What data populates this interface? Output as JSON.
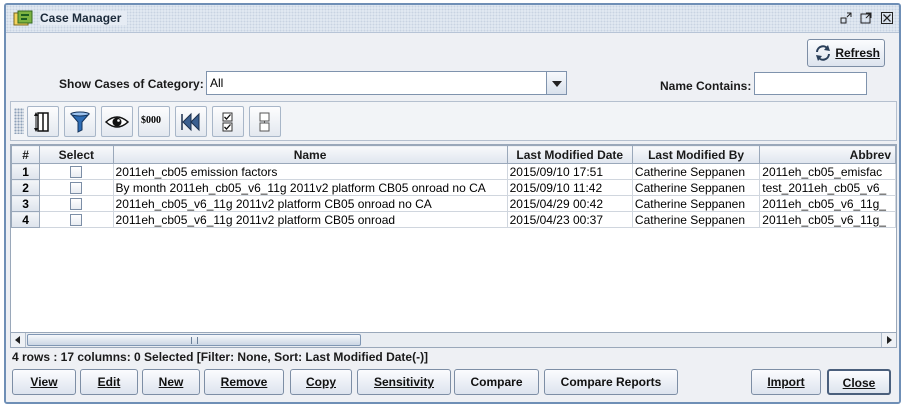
{
  "window": {
    "title": "Case Manager",
    "controls": [
      "minimize-icon",
      "maximize-icon",
      "close-icon"
    ]
  },
  "toolbar_top": {
    "refresh_label": "Refresh"
  },
  "filter": {
    "category_label": "Show Cases of Category:",
    "category_value": "All",
    "name_contains_label": "Name Contains:",
    "name_contains_value": ""
  },
  "icon_toolbar": [
    "column-resize-icon",
    "filter-funnel-icon",
    "view-eye-icon",
    "format-money-icon",
    "rewind-icon",
    "select-all-icon",
    "clear-selection-icon"
  ],
  "icon_toolbar_money_text": "$000",
  "table": {
    "columns": [
      "#",
      "Select",
      "Name",
      "Last Modified Date",
      "Last Modified By",
      "Abbrev"
    ],
    "rows": [
      {
        "num": "1",
        "name": "2011eh_cb05 emission factors",
        "date": "2015/09/10 17:51",
        "by": "Catherine Seppanen",
        "abbrev": "2011eh_cb05_emisfac"
      },
      {
        "num": "2",
        "name": "By month 2011eh_cb05_v6_11g 2011v2 platform CB05 onroad no CA",
        "date": "2015/09/10 11:42",
        "by": "Catherine Seppanen",
        "abbrev": "test_2011eh_cb05_v6_"
      },
      {
        "num": "3",
        "name": "2011eh_cb05_v6_11g 2011v2 platform CB05 onroad no CA",
        "date": "2015/04/29 00:42",
        "by": "Catherine Seppanen",
        "abbrev": "2011eh_cb05_v6_11g_"
      },
      {
        "num": "4",
        "name": "2011eh_cb05_v6_11g 2011v2 platform CB05 onroad",
        "date": "2015/04/23 00:37",
        "by": "Catherine Seppanen",
        "abbrev": "2011eh_cb05_v6_11g_"
      }
    ]
  },
  "status_text": "4 rows : 17 columns: 0 Selected [Filter: None, Sort: Last Modified Date(-)]",
  "buttons": {
    "view": "View",
    "edit": "Edit",
    "new": "New",
    "remove": "Remove",
    "copy": "Copy",
    "sensitivity": "Sensitivity",
    "compare": "Compare",
    "compare_reports": "Compare Reports",
    "import": "Import",
    "close": "Close"
  }
}
